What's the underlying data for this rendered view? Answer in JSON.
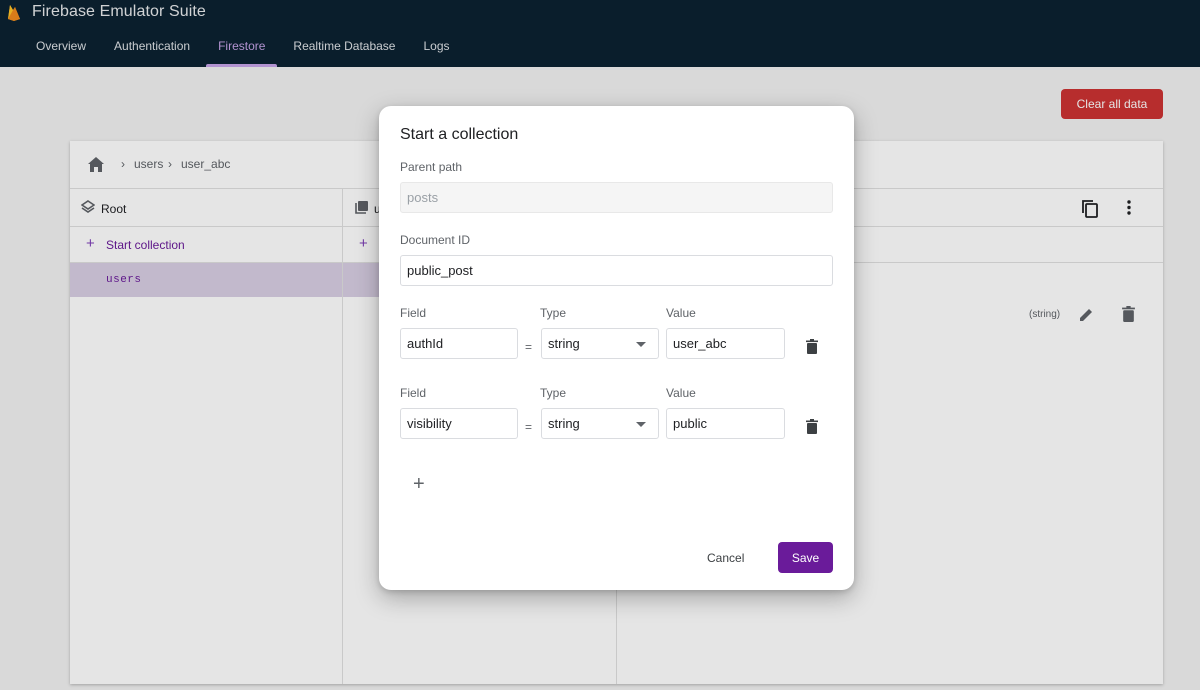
{
  "app": {
    "title": "Firebase Emulator Suite"
  },
  "nav": {
    "tabs": [
      {
        "label": "Overview"
      },
      {
        "label": "Authentication"
      },
      {
        "label": "Firestore"
      },
      {
        "label": "Realtime Database"
      },
      {
        "label": "Logs"
      }
    ],
    "active": "Firestore"
  },
  "toolbar": {
    "clear_label": "Clear all data"
  },
  "breadcrumb": {
    "items": [
      "users",
      "user_abc"
    ]
  },
  "columns": {
    "root": {
      "title": "Root",
      "action": "Start collection",
      "items": [
        "users"
      ]
    },
    "collection": {
      "title_visible": "u",
      "action_icon": "+"
    },
    "document": {
      "field_type": "(string)"
    }
  },
  "dialog": {
    "title": "Start a collection",
    "parent_path_label": "Parent path",
    "parent_path_value": "posts",
    "doc_id_label": "Document ID",
    "doc_id_value": "public_post",
    "fields": [
      {
        "field_label": "Field",
        "type_label": "Type",
        "value_label": "Value",
        "field": "authId",
        "type": "string",
        "value": "user_abc"
      },
      {
        "field_label": "Field",
        "type_label": "Type",
        "value_label": "Value",
        "field": "visibility",
        "type": "string",
        "value": "public"
      }
    ],
    "eq": "=",
    "add_icon": "+",
    "cancel_label": "Cancel",
    "save_label": "Save"
  },
  "colors": {
    "header_bg": "#0c2231",
    "accent": "#6a1b9a",
    "danger": "#cc3333",
    "nav_active": "#c7a4e8"
  }
}
